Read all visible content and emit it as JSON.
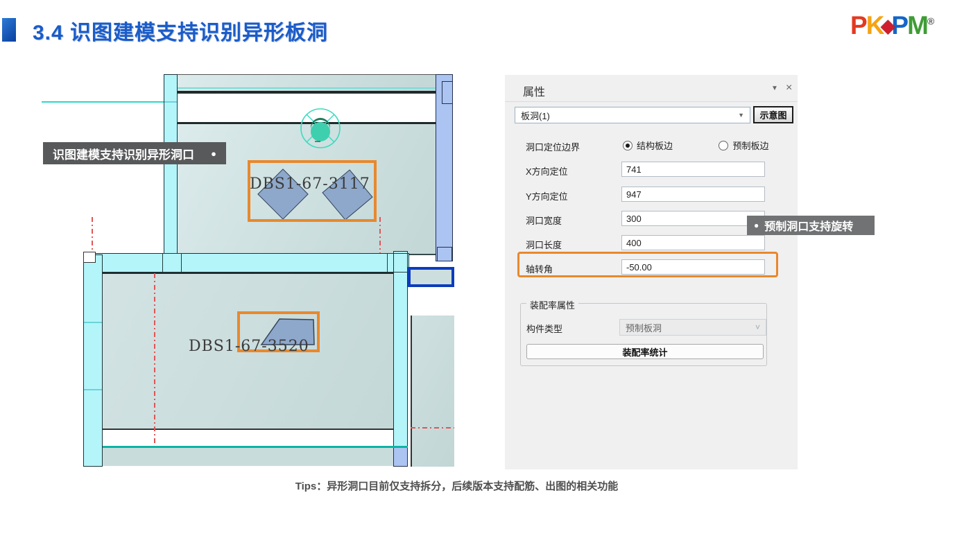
{
  "slide": {
    "title": "3.4 识图建模支持识别异形板洞",
    "tips": "Tips：异形洞口目前仅支持拆分，后续版本支持配筋、出图的相关功能"
  },
  "logo": {
    "p1": "P",
    "k": "K",
    "diamond": "◆",
    "p2": "P",
    "m": "M",
    "registered": "®"
  },
  "callouts": {
    "left": {
      "text": "识图建模支持识别异形洞口",
      "bullet": "●"
    },
    "right": {
      "text": "预制洞口支持旋转",
      "bullet": "●"
    }
  },
  "drawing": {
    "hole_label_1": "DBS1-67-3117",
    "hole_label_2": "DBS1-67-3520"
  },
  "panel": {
    "title": "属性",
    "icons": {
      "collapse": "▼",
      "close": "×",
      "combo_caret": "▼",
      "dropdown_chevron": "˅"
    },
    "type_selector_value": "板洞(1)",
    "schematic_button": "示意图",
    "fields": {
      "boundary": {
        "label": "洞口定位边界",
        "options": [
          {
            "label": "结构板边",
            "selected": true
          },
          {
            "label": "预制板边",
            "selected": false
          }
        ]
      },
      "x": {
        "label": "X方向定位",
        "value": "741"
      },
      "y": {
        "label": "Y方向定位",
        "value": "947"
      },
      "width": {
        "label": "洞口宽度",
        "value": "300"
      },
      "length": {
        "label": "洞口长度",
        "value": "400"
      },
      "angle": {
        "label": "轴转角",
        "value": "-50.00"
      }
    },
    "assembly_group": {
      "legend": "装配率属性",
      "component_type_label": "构件类型",
      "component_type_value": "预制板洞",
      "stats_button": "装配率统计"
    }
  },
  "colors": {
    "title_blue": "#1a5cc9",
    "accent_orange": "#e9882c",
    "wall_cyan": "#b4f5fa",
    "wall_blue": "#abc4f2",
    "slab": "#cfe1e1",
    "callout_bg": "#58595b",
    "axis_red": "#e05555",
    "teal": "#2ad8cc",
    "deep_blue": "#0b3cbe"
  }
}
